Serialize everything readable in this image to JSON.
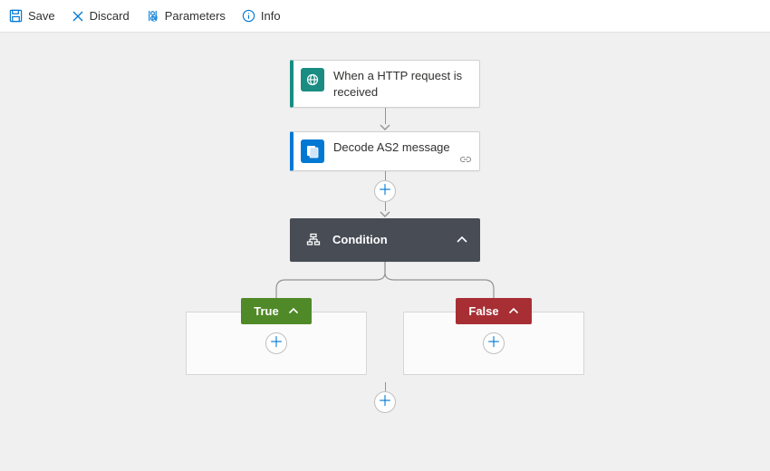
{
  "toolbar": {
    "save": "Save",
    "discard": "Discard",
    "parameters": "Parameters",
    "info": "Info"
  },
  "flow": {
    "trigger": {
      "label": "When a HTTP request is received"
    },
    "action1": {
      "label": "Decode AS2 message"
    },
    "condition": {
      "label": "Condition",
      "true_label": "True",
      "false_label": "False"
    }
  }
}
